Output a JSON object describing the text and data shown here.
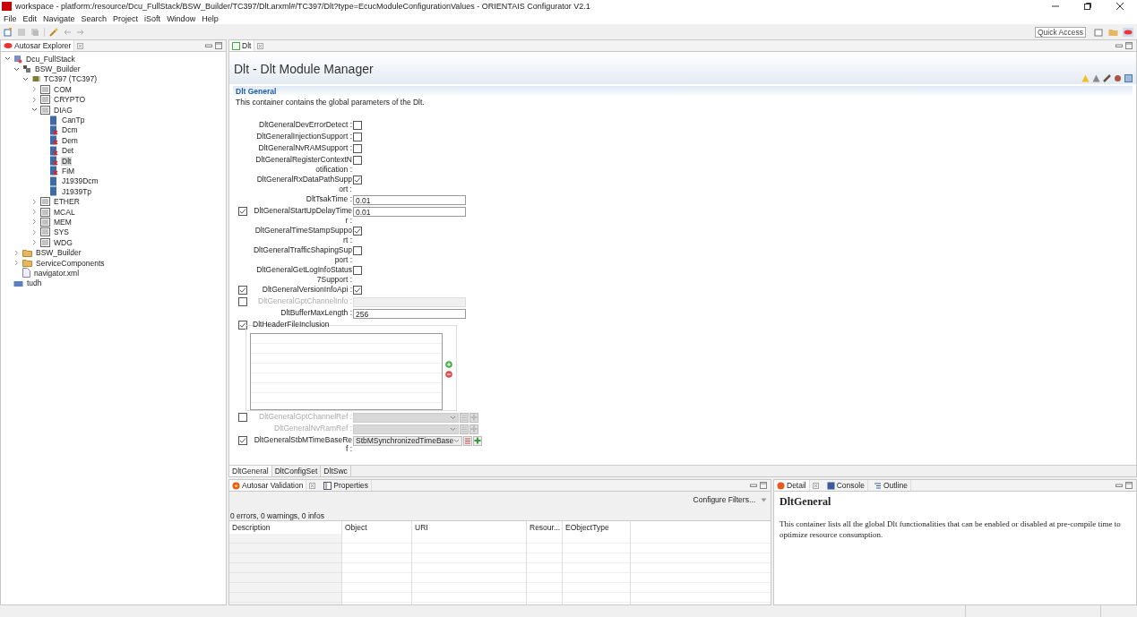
{
  "window": {
    "title": "workspace - platform:/resource/Dcu_FullStack/BSW_Builder/TC397/Dlt.arxml#/TC397/Dlt?type=EcucModuleConfigurationValues - ORIENTAIS Configurator V2.1"
  },
  "menu": [
    "File",
    "Edit",
    "Navigate",
    "Search",
    "Project",
    "iSoft",
    "Window",
    "Help"
  ],
  "quick_access": "Quick Access",
  "explorer": {
    "title": "Autosar Explorer",
    "tree": [
      {
        "label": "Dcu_FullStack",
        "kind": "project",
        "expanded": true,
        "selected": false,
        "children": [
          {
            "label": "BSW_Builder",
            "kind": "component",
            "expanded": true,
            "selected": false,
            "children": [
              {
                "label": "TC397 (TC397)",
                "kind": "ecu",
                "expanded": true,
                "selected": false,
                "children": [
                  {
                    "label": "COM",
                    "kind": "package",
                    "expanded": false,
                    "selected": false
                  },
                  {
                    "label": "CRYPTO",
                    "kind": "package",
                    "expanded": false,
                    "selected": false
                  },
                  {
                    "label": "DIAG",
                    "kind": "package",
                    "expanded": true,
                    "selected": false,
                    "children": [
                      {
                        "label": "CanTp",
                        "kind": "module",
                        "error": false,
                        "selected": false
                      },
                      {
                        "label": "Dcm",
                        "kind": "module",
                        "error": true,
                        "selected": false
                      },
                      {
                        "label": "Dem",
                        "kind": "module",
                        "error": true,
                        "selected": false
                      },
                      {
                        "label": "Det",
                        "kind": "module",
                        "error": true,
                        "selected": false
                      },
                      {
                        "label": "Dlt",
                        "kind": "module",
                        "error": true,
                        "selected": true
                      },
                      {
                        "label": "FiM",
                        "kind": "module",
                        "error": true,
                        "selected": false
                      },
                      {
                        "label": "J1939Dcm",
                        "kind": "module",
                        "error": false,
                        "selected": false
                      },
                      {
                        "label": "J1939Tp",
                        "kind": "module",
                        "error": false,
                        "selected": false
                      }
                    ]
                  },
                  {
                    "label": "ETHER",
                    "kind": "package",
                    "expanded": false,
                    "selected": false
                  },
                  {
                    "label": "MCAL",
                    "kind": "package",
                    "expanded": false,
                    "selected": false
                  },
                  {
                    "label": "MEM",
                    "kind": "package",
                    "expanded": false,
                    "selected": false
                  },
                  {
                    "label": "SYS",
                    "kind": "package",
                    "expanded": false,
                    "selected": false
                  },
                  {
                    "label": "WDG",
                    "kind": "package",
                    "expanded": false,
                    "selected": false
                  }
                ]
              }
            ]
          },
          {
            "label": "BSW_Builder",
            "kind": "folder",
            "expanded": false,
            "selected": false
          },
          {
            "label": "ServiceComponents",
            "kind": "folder",
            "expanded": false,
            "selected": false
          },
          {
            "label": "navigator.xml",
            "kind": "file",
            "selected": false
          }
        ]
      },
      {
        "label": "tudh",
        "kind": "user",
        "selected": false
      }
    ]
  },
  "editor": {
    "tab": "Dlt",
    "title": "Dlt - Dlt Module Manager",
    "section": "Dlt General",
    "description": "This container contains the global parameters of the Dlt.",
    "fields": [
      {
        "kind": "checkbox",
        "label": "DltGeneralDevErrorDetect :",
        "checked": false
      },
      {
        "kind": "checkbox",
        "label": "DltGeneralInjectionSupport :",
        "checked": false
      },
      {
        "kind": "checkbox",
        "label": "DltGeneralNvRAMSupport :",
        "checked": false
      },
      {
        "kind": "checkbox",
        "label": "DltGeneralRegisterContextNotification :",
        "checked": false
      },
      {
        "kind": "checkbox",
        "label": "DltGeneralRxDataPathSupport :",
        "checked": true
      },
      {
        "kind": "text",
        "label": "DltTsakTime :",
        "value": "0.01"
      },
      {
        "kind": "text",
        "label": "DltGeneralStartUpDelayTimer :",
        "value": "0.01",
        "enabled": true
      },
      {
        "kind": "checkbox",
        "label": "DltGeneralTimeStampSupport :",
        "checked": true
      },
      {
        "kind": "checkbox",
        "label": "DltGeneralTrafficShapingSupport :",
        "checked": false
      },
      {
        "kind": "checkbox",
        "label": "DltGeneralGetLogInfoStatus7Support :",
        "checked": false
      },
      {
        "kind": "checkbox",
        "label": "DltGeneralVersionInfoApi :",
        "checked": true,
        "enabled": true
      },
      {
        "kind": "text",
        "label": "DltGeneralGptChannelInfo :",
        "enabled": false
      },
      {
        "kind": "text",
        "label": "DltBufferMaxLength :",
        "value": "256"
      },
      {
        "kind": "list",
        "label": "DltHeaderFileInclusion",
        "enabled": true
      },
      {
        "kind": "reference",
        "label": "DltGeneralGptChannelRef :",
        "enabled": false
      },
      {
        "kind": "reference",
        "label": "DltGeneralNvRamRef :",
        "disabled": true
      },
      {
        "kind": "reference",
        "label": "DltGeneralStbMTimeBaseRef :",
        "value": "StbMSynchronizedTimeBase",
        "enabled": true
      }
    ],
    "tabs": [
      {
        "label": "DltGeneral",
        "selected": true
      },
      {
        "label": "DltConfigSet",
        "selected": false
      },
      {
        "label": "DltSwc",
        "selected": false
      }
    ]
  },
  "validation": {
    "tabs": [
      {
        "label": "Autosar Validation",
        "selected": true
      },
      {
        "label": "Properties",
        "selected": false
      }
    ],
    "configure": "Configure Filters...",
    "summary": "0 errors, 0 warnings, 0 infos",
    "columns": [
      "Description",
      "Object",
      "URI",
      "Resour...",
      "EObjectType"
    ]
  },
  "detail": {
    "tabs": [
      {
        "label": "Detail",
        "selected": true
      },
      {
        "label": "Console",
        "selected": false
      },
      {
        "label": "Outline",
        "selected": false
      }
    ],
    "heading": "DltGeneral",
    "text": "This container lists all the global Dlt functionalities that can be enabled or disabled at pre-compile time to optimize resource consumption."
  }
}
